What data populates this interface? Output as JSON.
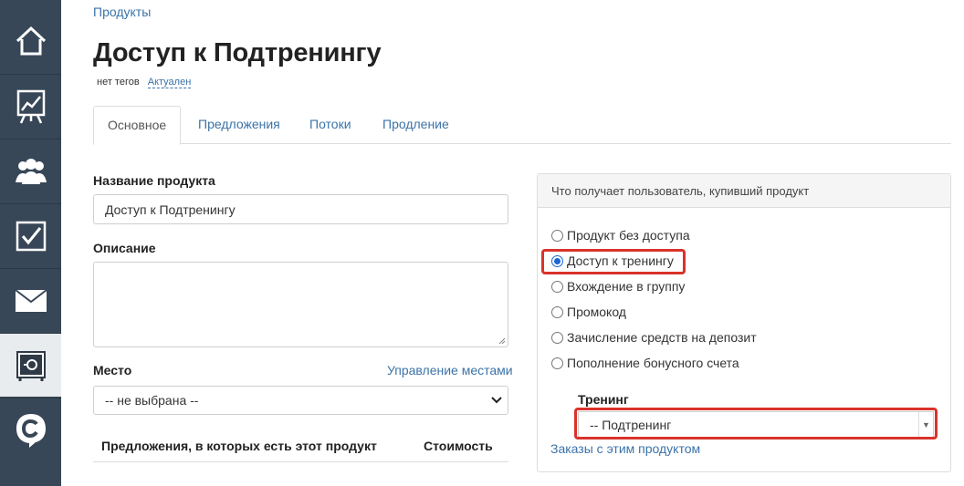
{
  "breadcrumb": "Продукты",
  "page_title": "Доступ к Подтренингу",
  "meta": {
    "tags": "нет тегов",
    "status": "Актуален"
  },
  "tabs": [
    {
      "label": "Основное",
      "active": true
    },
    {
      "label": "Предложения",
      "active": false
    },
    {
      "label": "Потоки",
      "active": false
    },
    {
      "label": "Продление",
      "active": false
    }
  ],
  "form": {
    "name_label": "Название продукта",
    "name_value": "Доступ к Подтренингу",
    "description_label": "Описание",
    "description_value": "",
    "place_label": "Место",
    "manage_places_link": "Управление местами",
    "place_selected": "-- не выбрана --"
  },
  "offers_table": {
    "headers": [
      "Предложения, в которых есть этот продукт",
      "Стоимость"
    ]
  },
  "panel": {
    "title": "Что получает пользователь, купивший продукт",
    "options": [
      {
        "label": "Продукт без доступа",
        "checked": false
      },
      {
        "label": "Доступ к тренингу",
        "checked": true
      },
      {
        "label": "Вхождение в группу",
        "checked": false
      },
      {
        "label": "Промокод",
        "checked": false
      },
      {
        "label": "Зачисление средств на депозит",
        "checked": false
      },
      {
        "label": "Пополнение бонусного счета",
        "checked": false
      }
    ],
    "training_label": "Тренинг",
    "training_selected": "-- Подтренинг",
    "orders_link": "Заказы с этим продуктом"
  },
  "sidebar": {
    "items": [
      {
        "icon": "home-icon"
      },
      {
        "icon": "chart-board-icon"
      },
      {
        "icon": "users-icon"
      },
      {
        "icon": "checkbox-icon"
      },
      {
        "icon": "envelope-icon"
      },
      {
        "icon": "safe-icon",
        "active": true
      },
      {
        "icon": "chat-logo-icon"
      }
    ]
  },
  "colors": {
    "sidebar": "#384757",
    "link": "#3b73a8",
    "highlight": "#d9332b"
  }
}
